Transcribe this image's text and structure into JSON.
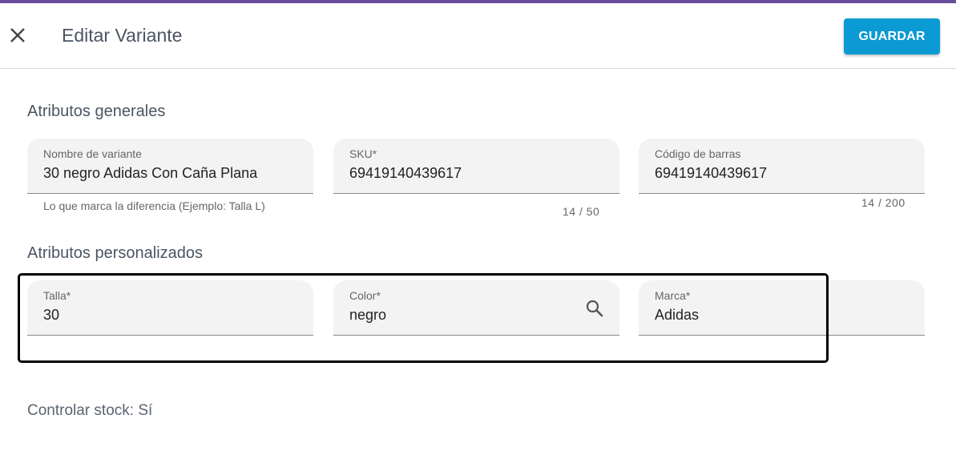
{
  "header": {
    "title": "Editar Variante",
    "save_label": "GUARDAR",
    "close_icon": "close-icon"
  },
  "general": {
    "title": "Atributos generales",
    "fields": [
      {
        "label": "Nombre de variante",
        "value": "30 negro Adidas Con Caña Plana",
        "hint": "Lo que marca la diferencia (Ejemplo: Talla L)"
      },
      {
        "label": "SKU*",
        "value": "69419140439617",
        "counter": "14 / 50"
      },
      {
        "label": "Código de barras",
        "value": "69419140439617",
        "counter": "14 / 200"
      }
    ]
  },
  "custom": {
    "title": "Atributos personalizados",
    "fields": [
      {
        "label": "Talla*",
        "value": "30"
      },
      {
        "label": "Color*",
        "value": "negro",
        "icon": "search-icon"
      },
      {
        "label": "Marca*",
        "value": "Adidas"
      }
    ]
  },
  "stock_text": "Controlar stock: Sí",
  "colors": {
    "accent": "#0b9ad3",
    "topline": "#6a4c9c",
    "field_bg": "#f3f3f3"
  }
}
